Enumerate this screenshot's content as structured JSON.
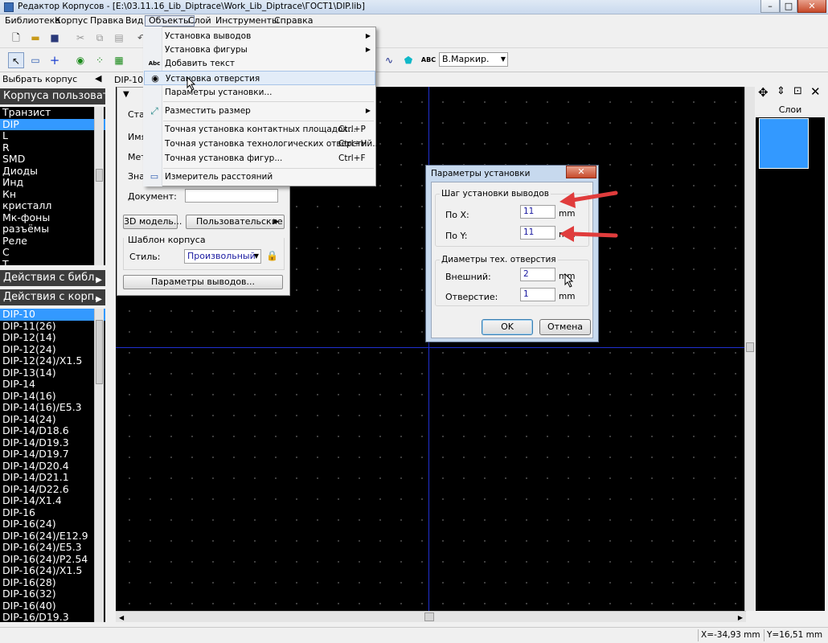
{
  "window": {
    "title": "Редактор Корпусов - [E:\\03.11.16_Lib_Diptrace\\Work_Lib_Diptrace\\ГОСТ1\\DIP.lib]",
    "min": "–",
    "max": "□",
    "close": "✕"
  },
  "menubar": [
    "Библиотека",
    "Корпус",
    "Правка",
    "Вид",
    "Объекты",
    "Слой",
    "Инструменты",
    "Справка"
  ],
  "toolbar2": {
    "marker_combo": "В.Маркир."
  },
  "left_panel": {
    "header_select": "Выбрать корпус",
    "user_packages": "Корпуса пользовате.",
    "categories": [
      "Транзист",
      "DIP",
      "L",
      "R",
      "SMD",
      "Диоды",
      "Инд",
      "Кн",
      "кристалл",
      "Мк-фоны",
      "разъёмы",
      "Реле",
      "С",
      "Т"
    ],
    "selected_category": 1,
    "lib_actions": "Действия с библ.",
    "pkg_actions": "Действия с корп.",
    "packages": [
      "DIP-10",
      "DIP-11(26)",
      "DIP-12(14)",
      "DIP-12(24)",
      "DIP-12(24)/X1.5",
      "DIP-13(14)",
      "DIP-14",
      "DIP-14(16)",
      "DIP-14(16)/E5.3",
      "DIP-14(24)",
      "DIP-14/D18.6",
      "DIP-14/D19.3",
      "DIP-14/D19.7",
      "DIP-14/D20.4",
      "DIP-14/D21.1",
      "DIP-14/D22.6",
      "DIP-14/X1.4",
      "DIP-16",
      "DIP-16(24)",
      "DIP-16(24)/E12.9",
      "DIP-16(24)/E5.3",
      "DIP-16(24)/P2.54",
      "DIP-16(24)/X1.5",
      "DIP-16(28)",
      "DIP-16(32)",
      "DIP-16(40)",
      "DIP-16/D19.3"
    ],
    "selected_package": 0
  },
  "tab_label": "DIP-10 К",
  "props_panel": {
    "label_stan": "Стан",
    "label_name": "Имя",
    "label_met": "Мет",
    "label_zna": "Знач",
    "label_document": "Документ:",
    "btn_3d": "3D модель...",
    "btn_user": "Пользовательские",
    "template_title": "Шаблон корпуса",
    "style_label": "Стиль:",
    "style_value": "Произвольный",
    "btn_pin_params": "Параметры выводов..."
  },
  "dropdown": {
    "items": [
      {
        "label": "Установка выводов",
        "submenu": true
      },
      {
        "label": "Установка фигуры",
        "submenu": true
      },
      {
        "label": "Добавить текст",
        "icon": "Abc"
      },
      {
        "label": "Установка отверстия",
        "icon": "◉"
      },
      {
        "label": "Параметры установки..."
      },
      {
        "label": "Разместить размер",
        "submenu": true
      },
      {
        "label": "Точная установка контактных площадок...",
        "shortcut": "Ctrl+P"
      },
      {
        "label": "Точная установка технологических отверстий...",
        "shortcut": "Ctrl+H"
      },
      {
        "label": "Точная установка фигур...",
        "shortcut": "Ctrl+F"
      },
      {
        "label": "Измеритель расстояний"
      }
    ]
  },
  "dialog": {
    "title": "Параметры установки",
    "group1_title": "Шаг установки выводов",
    "x_label": "По X:",
    "x_value": "11",
    "x_unit": "mm",
    "y_label": "По Y:",
    "y_value": "11",
    "y_unit": "mm",
    "group2_title": "Диаметры тех. отверстия",
    "outer_label": "Внешний:",
    "outer_value": "2",
    "outer_unit": "mm",
    "hole_label": "Отверстие:",
    "hole_value": "1",
    "hole_unit": "mm",
    "ok": "OK",
    "cancel": "Отмена"
  },
  "right_panel": {
    "layers_title": "Слои"
  },
  "status": {
    "x": "X=-34,93 mm",
    "y": "Y=16,51 mm"
  },
  "colors": {
    "list_bg": "#000000",
    "selection": "#3399ff",
    "canvas_axis": "#2030d0",
    "arrow": "#e03c3c"
  }
}
